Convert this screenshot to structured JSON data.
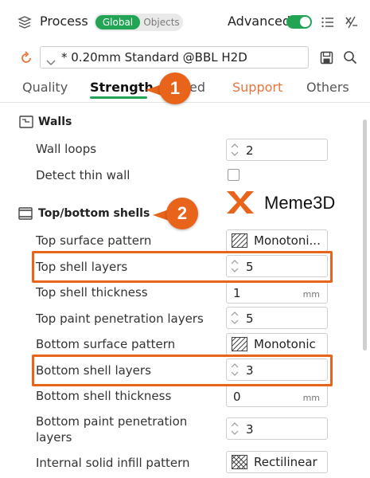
{
  "header": {
    "title": "Process",
    "global_label": "Global",
    "objects_label": "Objects",
    "advanced_label": "Advanced",
    "advanced_on": true
  },
  "preset": {
    "name": "* 0.20mm Standard @BBL H2D"
  },
  "tabs": [
    {
      "label": "Quality"
    },
    {
      "label": "Strength",
      "active": true
    },
    {
      "label": "ed"
    },
    {
      "label": "Support"
    },
    {
      "label": "Others"
    }
  ],
  "sections": {
    "walls": {
      "title": "Walls",
      "wall_loops": {
        "label": "Wall loops",
        "value": "2"
      },
      "detect_thin_wall": {
        "label": "Detect thin wall",
        "checked": false
      }
    },
    "shells": {
      "title": "Top/bottom shells",
      "top_surface_pattern": {
        "label": "Top surface pattern",
        "value": "Monotoni..."
      },
      "top_shell_layers": {
        "label": "Top shell layers",
        "value": "5"
      },
      "top_shell_thickness": {
        "label": "Top shell thickness",
        "value": "1",
        "unit": "mm"
      },
      "top_paint_penetration_layers": {
        "label": "Top paint penetration layers",
        "value": "5"
      },
      "bottom_surface_pattern": {
        "label": "Bottom surface pattern",
        "value": "Monotonic"
      },
      "bottom_shell_layers": {
        "label": "Bottom shell layers",
        "value": "3"
      },
      "bottom_shell_thickness": {
        "label": "Bottom shell thickness",
        "value": "0",
        "unit": "mm"
      },
      "bottom_paint_penetration_layers": {
        "label_line1": "Bottom paint penetration",
        "label_line2": "layers",
        "value": "3"
      },
      "internal_solid_infill_pattern": {
        "label": "Internal solid infill pattern",
        "value": "Rectilinear"
      }
    }
  },
  "annotations": {
    "badge_1": "1",
    "badge_2": "2"
  },
  "watermark": {
    "brand": "Meme3D"
  },
  "colors": {
    "accent_green": "#21a454",
    "highlight_orange": "#e8641b",
    "support_tab": "#e8743b"
  }
}
